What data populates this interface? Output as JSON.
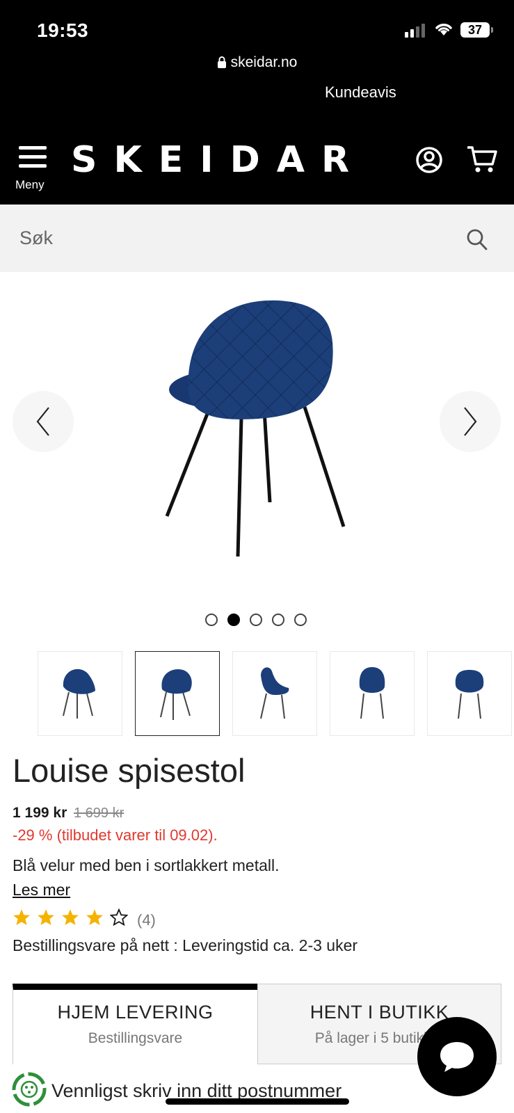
{
  "status_bar": {
    "time": "19:53",
    "battery": "37"
  },
  "browser": {
    "url": "skeidar.no",
    "kundeavis": "Kundeavis"
  },
  "header": {
    "logo": "SKEIDAR",
    "menu_label": "Meny"
  },
  "search": {
    "placeholder": "Søk"
  },
  "gallery": {
    "image_count": 5,
    "active_index": 1,
    "selected_thumb": 1
  },
  "product": {
    "title": "Louise spisestol",
    "price": "1 199 kr",
    "old_price": "1 699 kr",
    "discount": "-29 % (tilbudet varer til 09.02).",
    "description": "Blå velur med ben i sortlakkert metall.",
    "read_more": "Les mer",
    "rating": 4,
    "rating_max": 5,
    "rating_count": "(4)",
    "delivery_info": "Bestillingsvare på nett : Leveringstid ca. 2-3 uker"
  },
  "tabs": {
    "home": {
      "title": "HJEM LEVERING",
      "sub": "Bestillingsvare"
    },
    "store": {
      "title": "HENT I BUTIKK",
      "sub": "På lager i 5 butikker"
    }
  },
  "postnr_prompt": "Vennligst skriv inn ditt postnummer",
  "colors": {
    "accent_red": "#e0392f",
    "chair_blue": "#1c3f7a",
    "header_bg": "#000000"
  }
}
